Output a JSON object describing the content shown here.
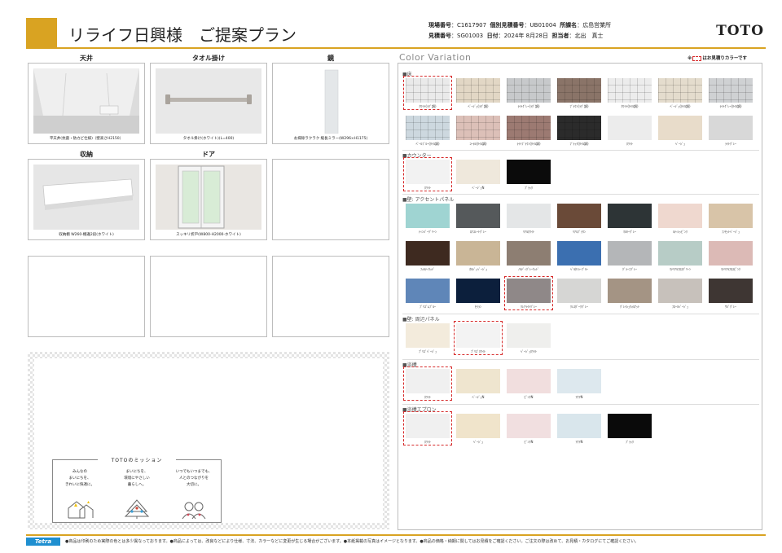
{
  "header": {
    "title": "リライフ日興様　ご提案プラン",
    "site_no_label": "現場番号",
    "site_no": "C1617907",
    "individual_no_label": "個別見積番号",
    "individual_no": "UB01004",
    "office_label": "所課名",
    "office": "広島営業所",
    "estimate_no_label": "見積番号",
    "estimate_no": "SG01003",
    "date_label": "日付",
    "date": "2024年 8月28日",
    "staff_label": "担当者",
    "staff": "北出　真士",
    "brand": "TOTO",
    "accent_color": "#d9a322"
  },
  "products": [
    {
      "label": "天井",
      "caption": "平天井(抗菌・防カビ仕様)（壁高さH2150）"
    },
    {
      "label": "タオル掛け",
      "caption": "タオル掛け(ホワイト)(L=400)"
    },
    {
      "label": "鏡",
      "caption": "お掃除ラクラク 縦長ミラー(W296×H1175)"
    },
    {
      "label": "収納",
      "caption": "収納棚 W260-棚違2段(ホワイト)"
    },
    {
      "label": "ドア",
      "caption": "スッキリ折戸(W800-H2000-ホワイト)"
    }
  ],
  "mission": {
    "title": "TOTOのミッション",
    "columns": [
      {
        "text": "みんなの\nまいにちを、\nきれいに快適に。"
      },
      {
        "text": "まいにちを、\n環境にやさしい\n暮らしへ。"
      },
      {
        "text": "いつでもいつまでも、\n人とのつながりを\n大切に。"
      }
    ]
  },
  "color_variation": {
    "title": "Color Variation",
    "note_prefix": "※",
    "note_suffix": "はお見積りカラーです",
    "selection_color": "#d62a2a",
    "sections": [
      {
        "title": "■床",
        "swatches": [
          {
            "name": "ﾎﾜｲﾄ(ﾗｸﾞ調)",
            "color": "#eaeaea",
            "tile": true,
            "selected": true
          },
          {
            "name": "ﾍﾞｰｼﾞｭ(ﾗｸﾞ調)",
            "color": "#e2d7c5",
            "tile": true
          },
          {
            "name": "ﾗｲﾄｸﾞﾚｰ(ﾗｸﾞ調)",
            "color": "#c7c9cb",
            "tile": true
          },
          {
            "name": "ﾌﾞﾗｳﾝ(ﾗｸﾞ調)",
            "color": "#8a7468",
            "tile": true
          },
          {
            "name": "ﾎﾜｲﾄ(ﾀｲﾙ調)",
            "color": "#ececec",
            "tile": true
          },
          {
            "name": "ﾍﾞｰｼﾞｭ(ﾀｲﾙ調)",
            "color": "#e4dccd",
            "tile": true
          },
          {
            "name": "ﾗｲﾄｸﾞﾚｰ(ﾀｲﾙ調)",
            "color": "#cfd1d3",
            "tile": true
          },
          {
            "name": "ﾍﾟｰﾙﾌﾞﾙｰ(ﾀｲﾙ調)",
            "color": "#cdd8df",
            "tile": true
          },
          {
            "name": "ｺｰﾗﾙ(ﾀｲﾙ調)",
            "color": "#dcc0b8",
            "tile": true
          },
          {
            "name": "ﾗｲﾄﾌﾞﾗｳﾝ(ﾀｲﾙ調)",
            "color": "#9c7a72",
            "tile": true
          },
          {
            "name": "ﾌﾞﾗｯｸ(ﾀｲﾙ調)",
            "color": "#2b2b2b",
            "tile": true
          },
          {
            "name": "ﾎﾜｲﾄ",
            "color": "#ececec"
          },
          {
            "name": "ﾍﾞｰｼﾞｭ",
            "color": "#e8dcca"
          },
          {
            "name": "ﾗｲﾄｸﾞﾚｰ",
            "color": "#d8d8d8"
          }
        ]
      },
      {
        "title": "■カウンター",
        "swatches": [
          {
            "name": "ﾎﾜｲﾄ",
            "color": "#f2f2f2",
            "selected": true
          },
          {
            "name": "ﾍﾞｰｼﾞｭN",
            "color": "#efe8dc"
          },
          {
            "name": "ﾌﾞﾗｯｸ",
            "color": "#0b0b0b"
          }
        ]
      },
      {
        "title": "■壁: アクセントパネル",
        "swatches": [
          {
            "name": "ﾃｨﾝﾊﾞｰｸﾞﾘｰﾝ",
            "color": "#9fd4d2"
          },
          {
            "name": "ﾛｱｽﾚｰﾄｸﾞﾚｰ",
            "color": "#55595b"
          },
          {
            "name": "ﾘｱﾙﾎﾜｲﾄ",
            "color": "#e4e6e7"
          },
          {
            "name": "ﾘｱﾙﾌﾞﾗｳﾝ",
            "color": "#6a4a38"
          },
          {
            "name": "ﾏﾙｷｰｸﾞﾚｰ",
            "color": "#2d3436"
          },
          {
            "name": "ﾙﾃｨｼｯﾋﾟﾝｸ",
            "color": "#efd8cf"
          },
          {
            "name": "ﾌｧｾｯﾄﾍﾞｰｼﾞｭ",
            "color": "#d8c4a8"
          },
          {
            "name": "ﾌｫﾙﾃｨｳｯﾄﾞ",
            "color": "#3e2a20"
          },
          {
            "name": "ｵﾙｼﾞｪﾍﾞｰｼﾞｭ",
            "color": "#c9b596"
          },
          {
            "name": "ﾉﾙﾃﾞｨｸﾞﾚｰｳｯﾄﾞ",
            "color": "#8d7e72"
          },
          {
            "name": "ﾍﾞﾙﾀﾝｼｰﾌﾞﾙｰ",
            "color": "#3b6fb0"
          },
          {
            "name": "ｸﾞﾗｰﾆｸﾞﾚｰ",
            "color": "#b4b6b8"
          },
          {
            "name": "ﾏﾃﾘｱﾙﾌﾛｽｸﾞﾘｰﾝ",
            "color": "#b7ccc6"
          },
          {
            "name": "ﾏﾃﾘｱﾙﾌﾛｽﾋﾟﾝｸ",
            "color": "#dcbab6"
          },
          {
            "name": "ﾌﾞﾘｽﾞﾑﾌﾞﾙｰ",
            "color": "#5f86b8"
          },
          {
            "name": "ｾｲﾗﾝ",
            "color": "#0c1f3c"
          },
          {
            "name": "ｸﾚｱﾗｲﾄｸﾞﾚｰ",
            "color": "#8f8888",
            "selected": true
          },
          {
            "name": "ｸﾚｽﾀﾞｰｸｸﾞﾚｰ",
            "color": "#d6d6d4"
          },
          {
            "name": "ｸﾞﾚｲｼｭｳｫﾙﾅｯﾄ",
            "color": "#a49484"
          },
          {
            "name": "ﾌﾛｰﾙﾍﾞｰｼﾞｭ",
            "color": "#c7c1bb"
          },
          {
            "name": "ｻﾊﾞｸﾞﾚｰ",
            "color": "#3e3633"
          }
        ]
      },
      {
        "title": "■壁: 周辺パネル",
        "swatches": [
          {
            "name": "ﾌﾟﾘｽﾞﾍﾞｰｼﾞｭ",
            "color": "#f3ebdc"
          },
          {
            "name": "ﾌﾟﾘｽﾞﾎﾜｲﾄ",
            "color": "#f3f3f3",
            "selected": true
          },
          {
            "name": "ﾍﾞｰｼﾞｭﾎﾜｲﾄ",
            "color": "#efefed"
          }
        ]
      },
      {
        "title": "■浴槽",
        "swatches": [
          {
            "name": "ﾎﾜｲﾄ",
            "color": "#f0f0f0",
            "selected": true
          },
          {
            "name": "ﾍﾞｰｼﾞｭN",
            "color": "#efe5cf"
          },
          {
            "name": "ﾋﾟﾝｸN",
            "color": "#f1dede"
          },
          {
            "name": "ｱｸｱN",
            "color": "#dde8ee"
          }
        ]
      },
      {
        "title": "■浴槽エプロン",
        "swatches": [
          {
            "name": "ﾎﾜｲﾄ",
            "color": "#f0f0f0",
            "selected": true
          },
          {
            "name": "ﾍﾞｰｼﾞｭ",
            "color": "#f0e4cb"
          },
          {
            "name": "ﾋﾟﾝｸN",
            "color": "#f1dfe0"
          },
          {
            "name": "ｱｸｱN",
            "color": "#d9e6ec"
          },
          {
            "name": "ﾌﾞﾗｯｸ",
            "color": "#0a0a0a"
          }
        ]
      }
    ]
  },
  "footer": {
    "logo": "Tetra",
    "note": "●商品は印刷のため実際の色とは多少異なっております。●商品によっては、改良などにより仕様、寸法、カラーなどに変更が生じる場合がございます。●本紙掲載の写真はイメージとなります。●商品の価格・納期に関してはお見積をご確認ください。ご注文の際は改めて、お見積・カタログにてご確認ください。"
  }
}
